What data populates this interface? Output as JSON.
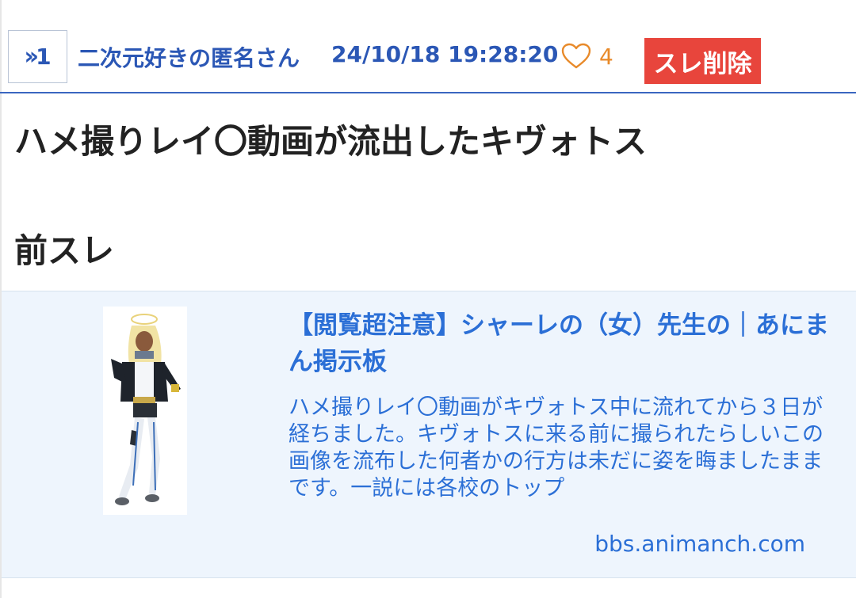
{
  "post": {
    "reply_number": "1",
    "author": "二次元好きの匿名さん",
    "timestamp": "24/10/18 19:28:20",
    "like_count": "4",
    "delete_label": "スレ削除",
    "title": "ハメ撮りレイ〇動画が流出したキヴォトス",
    "prev_thread_label": "前スレ"
  },
  "link_card": {
    "title": "【閲覧超注意】シャーレの（女）先生の｜あにまん掲示板",
    "description": "ハメ撮りレイ〇動画がキヴォトス中に流れてから３日が経ちました。キヴォトスに来る前に撮られたらしいこの画像を流布した何者かの行方は未だに姿を晦ましたままです。一説には各校のトップ",
    "domain": "bbs.animanch.com",
    "thumbnail_icon": "character-illustration"
  },
  "colors": {
    "accent_blue": "#2b57b5",
    "link_blue": "#2b6fd6",
    "like_orange": "#e88a2a",
    "delete_red": "#e8453c",
    "card_bg": "#eef5fd"
  }
}
